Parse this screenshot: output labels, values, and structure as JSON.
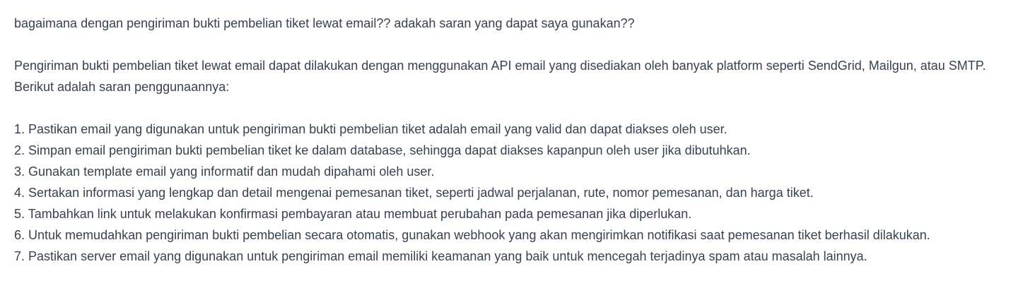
{
  "conversation": {
    "user_message": "bagaimana dengan pengiriman bukti pembelian tiket lewat email?? adakah saran yang dapat saya gunakan??",
    "assistant_intro": "Pengiriman bukti pembelian tiket lewat email dapat dilakukan dengan menggunakan API email yang disediakan oleh banyak platform seperti SendGrid, Mailgun, atau SMTP. Berikut adalah saran penggunaannya:",
    "steps": [
      {
        "number": "1.",
        "text": "Pastikan email yang digunakan untuk pengiriman bukti pembelian tiket adalah email yang valid dan dapat diakses oleh user."
      },
      {
        "number": "2.",
        "text": "Simpan email pengiriman bukti pembelian tiket ke dalam database, sehingga dapat diakses kapanpun oleh user jika dibutuhkan."
      },
      {
        "number": "3.",
        "text": "Gunakan template email yang informatif dan mudah dipahami oleh user."
      },
      {
        "number": "4.",
        "text": "Sertakan informasi yang lengkap dan detail mengenai pemesanan tiket, seperti jadwal perjalanan, rute, nomor pemesanan, dan harga tiket."
      },
      {
        "number": "5.",
        "text": "Tambahkan link untuk melakukan konfirmasi pembayaran atau membuat perubahan pada pemesanan jika diperlukan."
      },
      {
        "number": "6.",
        "text": "Untuk memudahkan pengiriman bukti pembelian secara otomatis, gunakan webhook yang akan mengirimkan notifikasi saat pemesanan tiket berhasil dilakukan."
      },
      {
        "number": "7.",
        "text": "Pastikan server email yang digunakan untuk pengiriman email memiliki keamanan yang baik untuk mencegah terjadinya spam atau masalah lainnya."
      }
    ]
  }
}
